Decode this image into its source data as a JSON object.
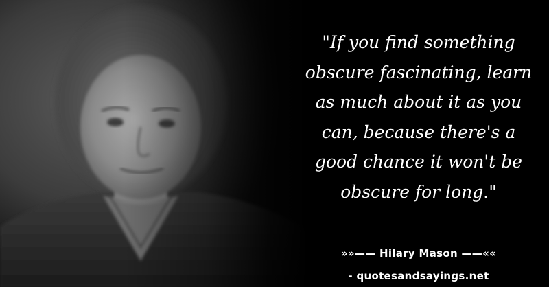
{
  "quote": {
    "lines": [
      "\"If you find something",
      "obscure fascinating, learn",
      "as much about it as you",
      "can, because there's a",
      "good chance it won't be",
      "obscure for long.\""
    ]
  },
  "attribution": {
    "author_text": "»»—— Hilary Mason ——««",
    "source_text": "- quotesandsayings.net"
  },
  "colors": {
    "background": "#000000",
    "text": "#ffffff"
  }
}
